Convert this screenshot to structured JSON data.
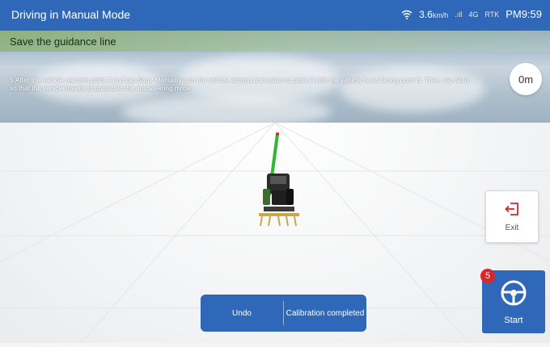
{
  "topbar": {
    "title": "Driving in Manual Mode",
    "speed": "3.6",
    "speed_unit": "km/h",
    "sig1": ".ıll",
    "sig2": "4G",
    "rtk": "RTK",
    "clock": "PM9:59"
  },
  "guidance": {
    "header": "Save the guidance line",
    "instruction": "5.After the vehicle reaches point A and tap Stop. Manually turn the vehicle around and return to point A with the vehicle head facing point B. Then, tap Start so that the vehicle travels to point B in the autosteering mode.",
    "distance": "0m"
  },
  "controls": {
    "exit_label": "Exit",
    "start_label": "Start",
    "start_badge": "5",
    "undo_label": "Undo",
    "calibration_label": "Calibration completed"
  },
  "colors": {
    "primary": "#2f68b8",
    "badge": "#d9262b",
    "guidance_line": "#2fb82f"
  },
  "icons": [
    "wifi-icon",
    "signal-icon",
    "exit-icon",
    "steering-wheel-icon",
    "tractor-icon"
  ]
}
